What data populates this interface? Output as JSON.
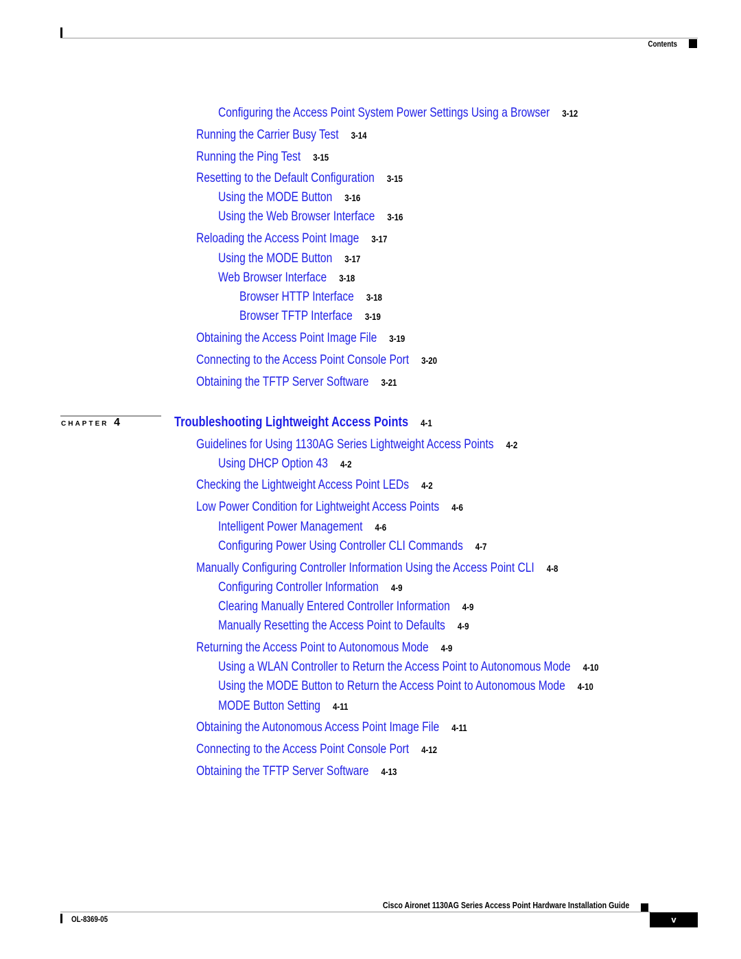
{
  "header": {
    "section_label": "Contents"
  },
  "entries_top": [
    {
      "title": "Configuring the Access Point System Power Settings Using a Browser",
      "page": "3-12",
      "level": 2
    },
    {
      "title": "Running the Carrier Busy Test",
      "page": "3-14",
      "level": 1
    },
    {
      "title": "Running the Ping Test",
      "page": "3-15",
      "level": 1
    },
    {
      "title": "Resetting to the Default Configuration",
      "page": "3-15",
      "level": 1
    },
    {
      "title": "Using the MODE Button",
      "page": "3-16",
      "level": 2
    },
    {
      "title": "Using the Web Browser Interface",
      "page": "3-16",
      "level": 2
    },
    {
      "title": "Reloading the Access Point Image",
      "page": "3-17",
      "level": 1
    },
    {
      "title": "Using the MODE Button",
      "page": "3-17",
      "level": 2
    },
    {
      "title": "Web Browser Interface",
      "page": "3-18",
      "level": 2
    },
    {
      "title": "Browser HTTP Interface",
      "page": "3-18",
      "level": 3
    },
    {
      "title": "Browser TFTP Interface",
      "page": "3-19",
      "level": 3
    },
    {
      "title": "Obtaining the Access Point Image File",
      "page": "3-19",
      "level": 1
    },
    {
      "title": "Connecting to the Access Point Console Port",
      "page": "3-20",
      "level": 1
    },
    {
      "title": "Obtaining the TFTP Server Software",
      "page": "3-21",
      "level": 1
    }
  ],
  "chapter": {
    "label": "CHAPTER",
    "number": "4",
    "title": "Troubleshooting Lightweight Access Points",
    "page": "4-1"
  },
  "entries_chapter": [
    {
      "title": "Guidelines for Using 1130AG Series Lightweight Access Points",
      "page": "4-2",
      "level": 1
    },
    {
      "title": "Using DHCP Option 43",
      "page": "4-2",
      "level": 2
    },
    {
      "title": "Checking the Lightweight Access Point LEDs",
      "page": "4-2",
      "level": 1
    },
    {
      "title": "Low Power Condition for Lightweight Access Points",
      "page": "4-6",
      "level": 1
    },
    {
      "title": "Intelligent Power Management",
      "page": "4-6",
      "level": 2
    },
    {
      "title": "Configuring Power Using Controller CLI Commands",
      "page": "4-7",
      "level": 2
    },
    {
      "title": "Manually Configuring Controller Information Using the Access Point CLI",
      "page": "4-8",
      "level": 1
    },
    {
      "title": "Configuring Controller Information",
      "page": "4-9",
      "level": 2
    },
    {
      "title": "Clearing Manually Entered Controller Information",
      "page": "4-9",
      "level": 2
    },
    {
      "title": "Manually Resetting the Access Point to Defaults",
      "page": "4-9",
      "level": 2
    },
    {
      "title": "Returning the Access Point to Autonomous Mode",
      "page": "4-9",
      "level": 1
    },
    {
      "title": "Using a WLAN Controller to Return the Access Point to Autonomous Mode",
      "page": "4-10",
      "level": 2
    },
    {
      "title": "Using the MODE Button to Return the Access Point to Autonomous Mode",
      "page": "4-10",
      "level": 2
    },
    {
      "title": "MODE Button Setting",
      "page": "4-11",
      "level": 2
    },
    {
      "title": "Obtaining the Autonomous Access Point Image File",
      "page": "4-11",
      "level": 1
    },
    {
      "title": "Connecting to the Access Point Console Port",
      "page": "4-12",
      "level": 1
    },
    {
      "title": "Obtaining the TFTP Server Software",
      "page": "4-13",
      "level": 1
    }
  ],
  "footer": {
    "guide_title": "Cisco Aironet 1130AG Series Access Point Hardware Installation Guide",
    "doc_number": "OL-8369-05",
    "page_number": "v"
  }
}
